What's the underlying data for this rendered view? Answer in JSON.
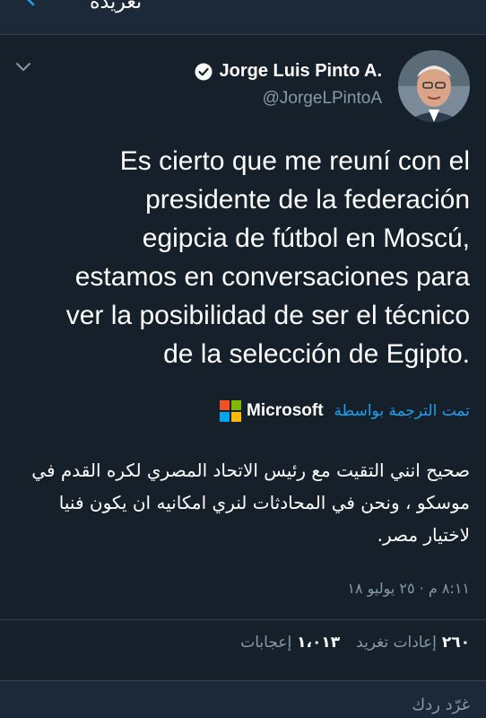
{
  "topbar": {
    "title": "تغريدة",
    "back_icon": "back-arrow-icon"
  },
  "colors": {
    "background": "#15202b",
    "accent": "#1da1f2",
    "secondary_text": "#8899a6",
    "ms_red": "#f25022",
    "ms_green": "#7fba00",
    "ms_blue": "#00a4ef",
    "ms_yellow": "#ffb900"
  },
  "tweet": {
    "display_name": "Jorge Luis Pinto A.",
    "handle": "@JorgeLPintoA",
    "verified_icon": "verified-badge-icon",
    "menu_icon": "chevron-down-icon",
    "text_lines": [
      "Es cierto que me reuní con el",
      "presidente de la federación",
      "egipcia de fútbol en Moscú,",
      "estamos en conversaciones para",
      "ver la posibilidad de ser el técnico",
      "de la selección de Egipto."
    ],
    "translated_by": "تمت الترجمة بواسطة",
    "translator": "Microsoft",
    "translation": "صحيح انني التقيت مع رئيس الاتحاد المصري لكره القدم في موسكو ، ونحن في المحادثات لنري امكانيه ان يكون فنيا لاختيار مصر.",
    "timestamp": "٨:١١ م · ٢٥ يوليو ١٨"
  },
  "stats": {
    "retweets_count": "٢٦٠",
    "retweets_label": "إعادات تغريد",
    "likes_count": "١،٠١٣",
    "likes_label": "إعجابات"
  },
  "reply": {
    "placeholder": "غرّد ردك"
  }
}
